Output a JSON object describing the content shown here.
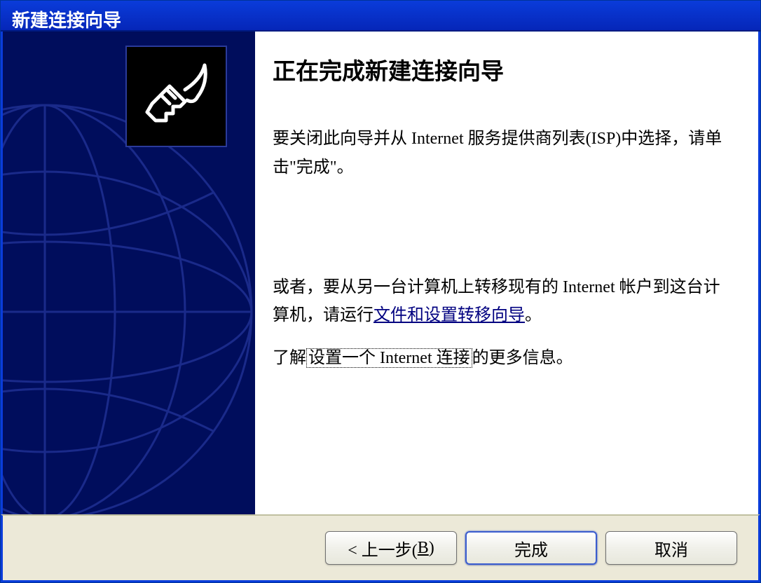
{
  "titlebar": {
    "title": "新建连接向导"
  },
  "main": {
    "heading": "正在完成新建连接向导",
    "para1": "要关闭此向导并从 Internet 服务提供商列表(ISP)中选择，请单击\"完成\"。",
    "para2_prefix": "或者，要从另一台计算机上转移现有的 Internet 帐户到这台计算机，请运行",
    "para2_link": "文件和设置转移向导",
    "para2_suffix": "。",
    "para3_prefix": "了解",
    "para3_link": "设置一个 Internet 连接",
    "para3_suffix": "的更多信息。"
  },
  "footer": {
    "back_prefix": "< 上一步(",
    "back_hotkey": "B",
    "back_suffix": ")",
    "finish": "完成",
    "cancel": "取消"
  },
  "icons": {
    "wizard_icon": "network-plug-icon"
  }
}
